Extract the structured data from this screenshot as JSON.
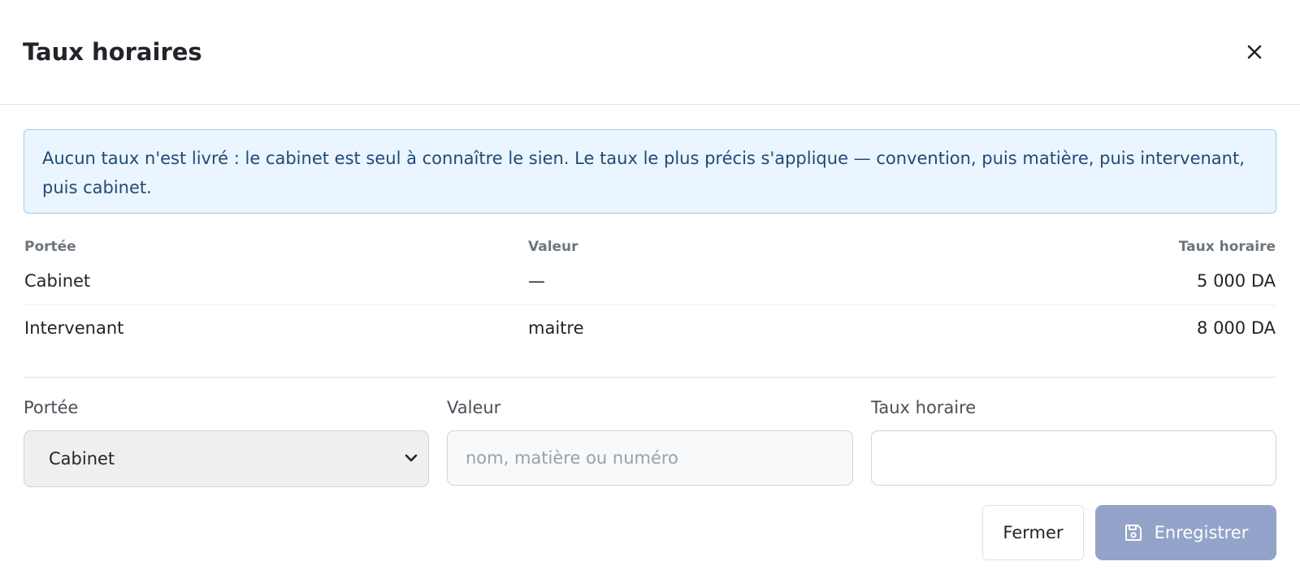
{
  "modal": {
    "title": "Taux horaires",
    "close_icon": "close-icon"
  },
  "alert": {
    "text": "Aucun taux n'est livré : le cabinet est seul à connaître le sien. Le taux le plus précis s'applique — convention, puis matière, puis intervenant, puis cabinet."
  },
  "table": {
    "headers": [
      "Portée",
      "Valeur",
      "Taux horaire"
    ],
    "rows": [
      {
        "portee": "Cabinet",
        "valeur": "—",
        "taux": "5 000 DA"
      },
      {
        "portee": "Intervenant",
        "valeur": "maitre",
        "taux": "8 000 DA"
      }
    ]
  },
  "form": {
    "portee_label": "Portée",
    "valeur_label": "Valeur",
    "taux_label": "Taux horaire",
    "portee_selected": "Cabinet",
    "valeur_placeholder": "nom, matière ou numéro",
    "valeur_value": "",
    "taux_value": ""
  },
  "buttons": {
    "fermer": "Fermer",
    "enregistrer": "Enregistrer",
    "save_icon": "floppy-disk-icon"
  },
  "colors": {
    "alert_bg": "#ebf5ff",
    "alert_border": "#9fcbe8",
    "alert_text": "#1f4a7a",
    "save_button_bg": "#93a3c9"
  }
}
